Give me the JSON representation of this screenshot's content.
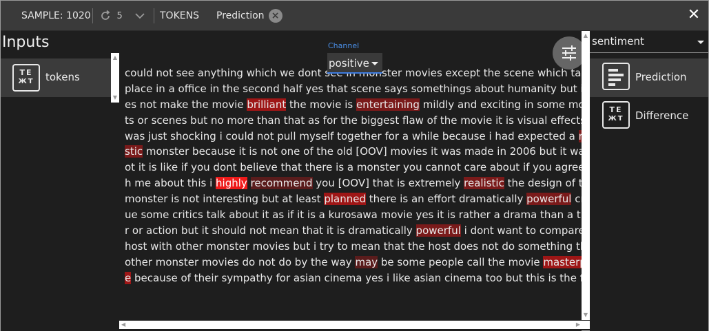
{
  "topbar": {
    "sample_label": "SAMPLE: 1020",
    "redo_count": "5",
    "tokens_label": "TOKENS",
    "prediction_chip": "Prediction",
    "chip_close_glyph": "×",
    "close_glyph": "✕"
  },
  "left_panel": {
    "title": "Inputs",
    "items": [
      {
        "label": "tokens",
        "icon_text": "TE\nXT"
      }
    ]
  },
  "main": {
    "channel_label": "Channel",
    "channel_value": "positive",
    "lines": [
      [
        {
          "t": "could not see anything which we dont see in monster movies except the scene which takes"
        }
      ],
      [
        {
          "t": "place in a office in the second half yes that scene says somethings about humanity but it do"
        }
      ],
      [
        {
          "t": "es not make the movie "
        },
        {
          "t": "brilliant",
          "c": "w3"
        },
        {
          "t": " the movie is "
        },
        {
          "t": "entertaining",
          "c": "w2"
        },
        {
          "t": " mildly and exciting in some momen"
        }
      ],
      [
        {
          "t": "ts or scenes but no more than that as for the biggest flaw of the movie it is visual effects it"
        }
      ],
      [
        {
          "t": "was just shocking i could not pull myself together for a while because i had expected a "
        },
        {
          "t": "reali",
          "c": "w2"
        }
      ],
      [
        {
          "t": "stic",
          "c": "w2"
        },
        {
          "t": " monster because it is not one of the old [OOV] movies it was made in 2006 but it was n"
        }
      ],
      [
        {
          "t": "ot it is like if you dont believe that there is a monster you cannot care about if you agree wit"
        }
      ],
      [
        {
          "t": "h me about this i "
        },
        {
          "t": "highly",
          "c": "w4"
        },
        {
          "t": " "
        },
        {
          "t": "recommend",
          "c": "w1"
        },
        {
          "t": " you [OOV] that is extremely "
        },
        {
          "t": "realistic",
          "c": "w2"
        },
        {
          "t": " the design of the"
        }
      ],
      [
        {
          "t": "monster is not interesting but at least "
        },
        {
          "t": "planned",
          "c": "w3"
        },
        {
          "t": " there is an effort dramatically "
        },
        {
          "t": "powerful",
          "c": "w2"
        },
        {
          "t": " critiq"
        }
      ],
      [
        {
          "t": "ue some critics talk about it as if it is a kurosawa movie yes it is rather a drama than a thrille"
        }
      ],
      [
        {
          "t": "r or action but it should not mean that it is dramatically "
        },
        {
          "t": "powerful",
          "c": "w2"
        },
        {
          "t": " i dont want to compare the"
        }
      ],
      [
        {
          "t": "host with other monster movies but i try to mean that the host does not do something that"
        }
      ],
      [
        {
          "t": "other monster movies do not do by the way "
        },
        {
          "t": "may",
          "c": "w1"
        },
        {
          "t": " be some people call the movie "
        },
        {
          "t": "masterpiec",
          "c": "w3"
        }
      ],
      [
        {
          "t": "e",
          "c": "w3"
        },
        {
          "t": " because of their sympathy for asian cinema yes i like asian cinema too but this is the fact"
        }
      ]
    ]
  },
  "right_panel": {
    "field_select": "sentiment",
    "items": [
      {
        "label": "Prediction",
        "icon": "bar-chart-icon",
        "selected": true
      },
      {
        "label": "Difference",
        "icon": "text-icon",
        "selected": false
      }
    ]
  },
  "colors": {
    "highlight_weak": "#5a1c1c",
    "highlight_mid": "#7a1a1a",
    "highlight_strong": "#9e1616",
    "highlight_max": "#ee1a1a",
    "accent_blue": "#3d7ce0"
  }
}
